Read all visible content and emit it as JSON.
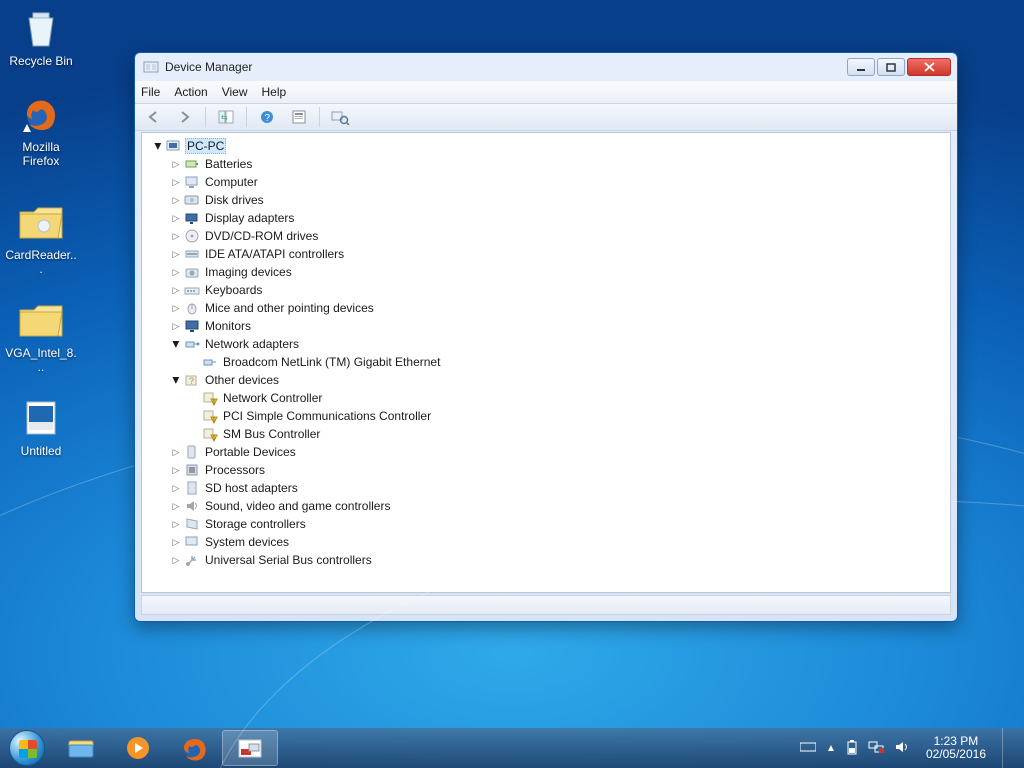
{
  "desktop_icons": [
    {
      "name": "Recycle Bin"
    },
    {
      "name": "Mozilla Firefox"
    },
    {
      "name": "CardReader..."
    },
    {
      "name": "VGA_Intel_8..."
    },
    {
      "name": "Untitled"
    }
  ],
  "window": {
    "title": "Device Manager",
    "menu": {
      "file": "File",
      "action": "Action",
      "view": "View",
      "help": "Help"
    }
  },
  "tree": {
    "root": "PC-PC",
    "batteries": "Batteries",
    "computer": "Computer",
    "disk_drives": "Disk drives",
    "display_adapters": "Display adapters",
    "dvd": "DVD/CD-ROM drives",
    "ide": "IDE ATA/ATAPI controllers",
    "imaging": "Imaging devices",
    "keyboards": "Keyboards",
    "mice": "Mice and other pointing devices",
    "monitors": "Monitors",
    "network_adapters": "Network adapters",
    "net_child_0": "Broadcom NetLink (TM) Gigabit Ethernet",
    "other_devices": "Other devices",
    "other_child_0": "Network Controller",
    "other_child_1": "PCI Simple Communications Controller",
    "other_child_2": "SM Bus Controller",
    "portable": "Portable Devices",
    "processors": "Processors",
    "sdhost": "SD host adapters",
    "sound": "Sound, video and game controllers",
    "storage": "Storage controllers",
    "system": "System devices",
    "usb": "Universal Serial Bus controllers"
  },
  "taskbar": {
    "time": "1:23 PM",
    "date": "02/05/2016"
  }
}
